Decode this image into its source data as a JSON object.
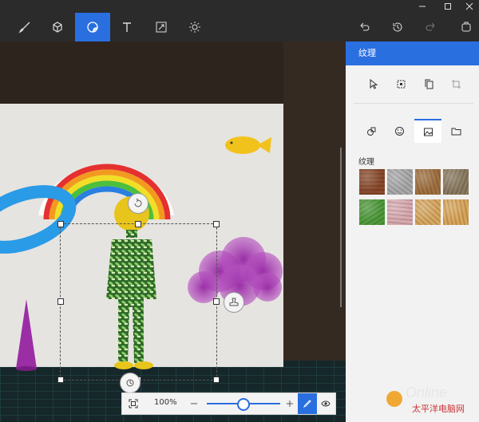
{
  "toolbar": {
    "tools": [
      {
        "name": "brushes",
        "icon": "brush-icon"
      },
      {
        "name": "3d-shapes",
        "icon": "cube-icon"
      },
      {
        "name": "stickers",
        "icon": "sticker-icon",
        "active": true
      },
      {
        "name": "text",
        "icon": "text-icon"
      },
      {
        "name": "canvas",
        "icon": "resize-icon"
      },
      {
        "name": "effects",
        "icon": "sun-icon"
      }
    ],
    "right": [
      "undo-icon",
      "history-icon",
      "redo-icon",
      "paste-3d-icon"
    ]
  },
  "panel": {
    "title": "纹理",
    "section_label": "纹理",
    "textures": [
      {
        "name": "bark",
        "color": "#8a4a2c"
      },
      {
        "name": "gravel",
        "color": "#a9a9a9"
      },
      {
        "name": "wood-grain",
        "color": "#a07040"
      },
      {
        "name": "pebbles",
        "color": "#8a7a60"
      },
      {
        "name": "leaves",
        "color": "#4f9a3c"
      },
      {
        "name": "marble",
        "color": "#d8aab0"
      },
      {
        "name": "sand",
        "color": "#d8a860"
      },
      {
        "name": "light-wood",
        "color": "#d9a559"
      }
    ]
  },
  "zoom": {
    "level": "100%",
    "slider_fraction": 0.42
  },
  "accent": "#2a6fe0",
  "watermark": "Online 太平洋电脑网"
}
